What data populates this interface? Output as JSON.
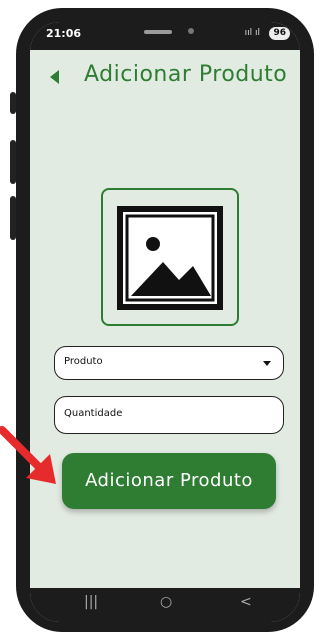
{
  "status_bar": {
    "time": "21:06",
    "signal": "ııl ıl",
    "battery": "96"
  },
  "header": {
    "title": "Adicionar Produto",
    "back_icon": "back-arrow-icon"
  },
  "form": {
    "image_placeholder_icon": "image-icon",
    "product_select": {
      "value": "Produto"
    },
    "quantity_field": {
      "placeholder": "Quantidade"
    },
    "submit_label": "Adicionar Produto"
  },
  "nav_bar": {
    "recents": "|||",
    "home": "○",
    "back": "<"
  },
  "colors": {
    "accent": "#2e7d32",
    "screen_bg": "#e2ebe2",
    "annotation_arrow": "#e52b2b"
  }
}
